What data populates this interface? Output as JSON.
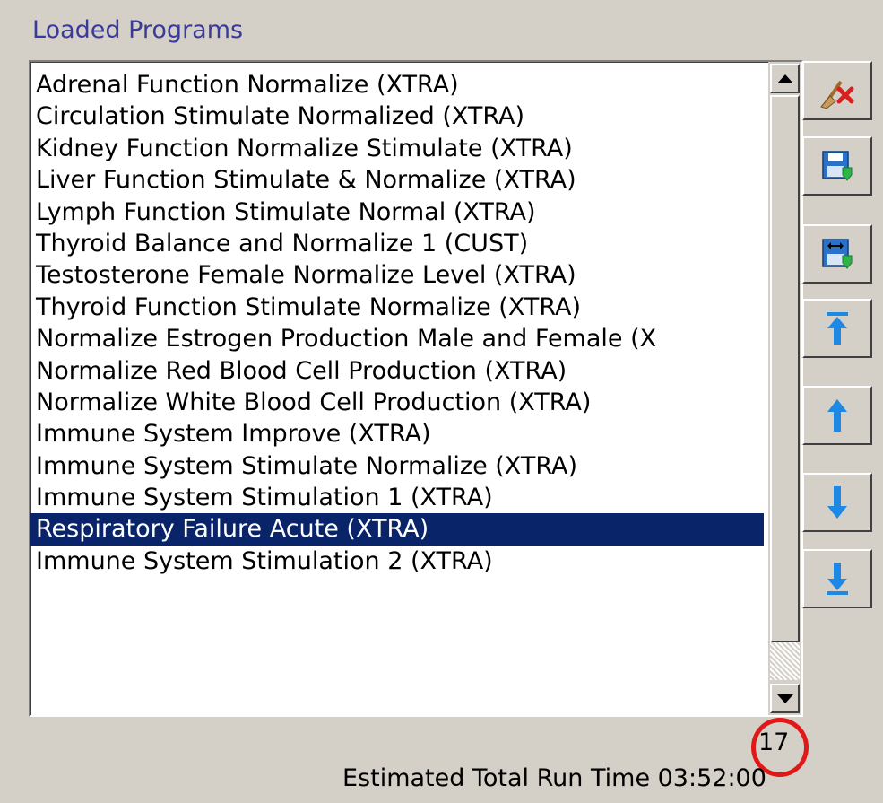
{
  "panel": {
    "title": "Loaded Programs"
  },
  "programs": [
    "Adrenal Function Normalize (XTRA)",
    "Circulation Stimulate Normalized (XTRA)",
    "Kidney Function Normalize Stimulate (XTRA)",
    "Liver Function Stimulate & Normalize (XTRA)",
    "Lymph Function Stimulate Normal (XTRA)",
    "Thyroid Balance and Normalize 1 (CUST)",
    "Testosterone Female Normalize Level (XTRA)",
    "Thyroid Function Stimulate Normalize (XTRA)",
    "Normalize Estrogen Production Male and Female (X",
    "Normalize Red Blood Cell Production (XTRA)",
    "Normalize White Blood Cell Production (XTRA)",
    "Immune System Improve (XTRA)",
    "Immune System Stimulate Normalize (XTRA)",
    "Immune System Stimulation 1 (XTRA)",
    "Respiratory Failure Acute (XTRA)",
    "Immune System Stimulation 2 (XTRA)"
  ],
  "selected_index": 14,
  "toolbar": {
    "icons": [
      "broom-delete-icon",
      "save-icon",
      "save-as-icon",
      "move-top-icon",
      "move-up-icon",
      "move-down-icon",
      "move-bottom-icon"
    ]
  },
  "colors": {
    "selection": "#0a246a",
    "title_text": "#3a3a9a",
    "annotation_circle": "#e01818",
    "icon_blue": "#1e88e5"
  },
  "program_count": "17",
  "runtime": {
    "label": "Estimated Total Run Time 03:52:00"
  }
}
